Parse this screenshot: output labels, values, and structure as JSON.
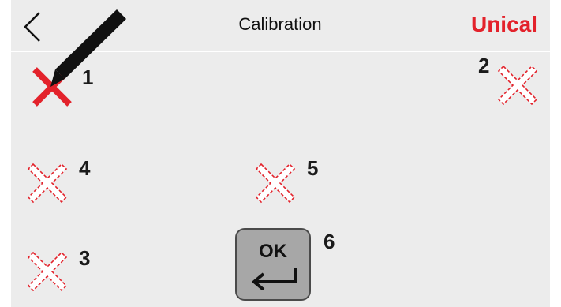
{
  "header": {
    "title": "Calibration",
    "brand": "Unical",
    "back_icon": "chevron-left-icon"
  },
  "targets": [
    {
      "label": "1",
      "state": "active"
    },
    {
      "label": "2",
      "state": "pending"
    },
    {
      "label": "3",
      "state": "pending"
    },
    {
      "label": "4",
      "state": "pending"
    },
    {
      "label": "5",
      "state": "pending"
    }
  ],
  "ok_button": {
    "label": "OK",
    "number": "6",
    "icon": "enter-arrow-icon"
  },
  "colors": {
    "accent": "#e3222b",
    "background": "#ececec",
    "button": "#a7a7a7"
  }
}
